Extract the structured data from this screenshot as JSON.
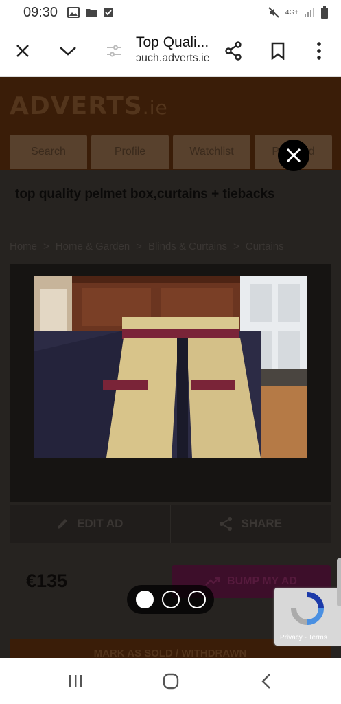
{
  "status_bar": {
    "time": "09:30",
    "network": "4G+"
  },
  "browser": {
    "page_title": "Top Quali...",
    "url_host": "ɔuch.adverts.ie",
    "icons": [
      "close-icon",
      "chevron-down-icon",
      "page-settings-icon",
      "share-icon",
      "bookmark-icon",
      "more-vert-icon"
    ]
  },
  "site": {
    "logo_main": "ADVERTS",
    "logo_suffix": ".ie",
    "nav": [
      "Search",
      "Profile",
      "Watchlist",
      "Place ad"
    ]
  },
  "ad": {
    "title": "top quality pelmet box,curtains + tiebacks",
    "breadcrumb": [
      "Home",
      "Home & Garden",
      "Blinds & Curtains",
      "Curtains"
    ],
    "breadcrumb_separator": ">",
    "edit_label": "EDIT AD",
    "share_label": "SHARE",
    "price": "€135",
    "bump_label": "BUMP MY AD",
    "mark_sold_label": "MARK AS SOLD / WITHDRAWN"
  },
  "recaptcha": {
    "terms": "Privacy - Terms"
  },
  "lightbox": {
    "image_count": 3,
    "active_index": 0,
    "close_icon": "close-icon"
  },
  "colors": {
    "brand_orange_dimmed": "#3a1d08",
    "bump_purple_dimmed": "#3d0e2a",
    "curtain_gold": "#d8c48a",
    "fringe_burgundy": "#7a2438"
  }
}
